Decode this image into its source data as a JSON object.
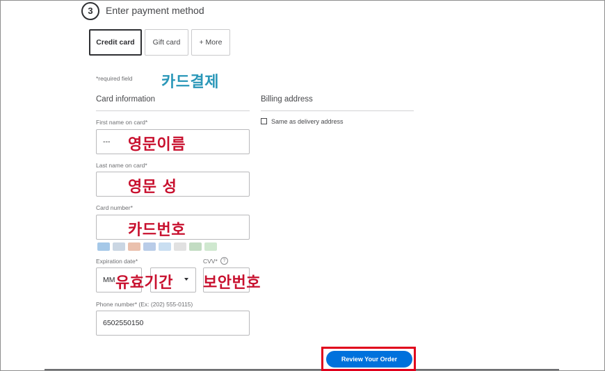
{
  "header": {
    "step_number": "3",
    "title": "Enter payment method"
  },
  "tabs": [
    {
      "label": "Credit card",
      "active": true
    },
    {
      "label": "Gift card",
      "active": false
    },
    {
      "label": "+ More",
      "active": false
    }
  ],
  "required_note": "*required field",
  "card_section": {
    "title": "Card information",
    "first_name": {
      "label": "First name on card*",
      "value": "---"
    },
    "last_name": {
      "label": "Last name on card*",
      "value": ""
    },
    "card_number": {
      "label": "Card number*",
      "value": ""
    },
    "card_logos": [
      "amex-logo",
      "discover-logo",
      "mastercard-logo",
      "visa-logo",
      "amex-logo-2",
      "discover-logo-2",
      "card-logo-green",
      "card-logo-green-2"
    ],
    "expiration": {
      "label": "Expiration date*",
      "month_value": "MM"
    },
    "cvv": {
      "label": "CVV*",
      "help_glyph": "?"
    },
    "phone": {
      "label": "Phone number* (Ex: (202) 555-0115)",
      "value": "6502550150"
    }
  },
  "billing_section": {
    "title": "Billing address",
    "same_as_delivery_label": "Same as delivery address",
    "same_as_delivery_checked": false
  },
  "annotations": {
    "card_payment": "카드결제",
    "english_first_name": "영문이름",
    "english_last_name": "영문 성",
    "card_number": "카드번호",
    "expiration": "유효기간",
    "security_code": "보안번호"
  },
  "review_button": {
    "label": "Review Your Order"
  },
  "colors": {
    "accent": "#0071dc",
    "highlight": "#e0001b",
    "annotation_red": "#c8102e",
    "annotation_blue": "#2a97b8"
  }
}
